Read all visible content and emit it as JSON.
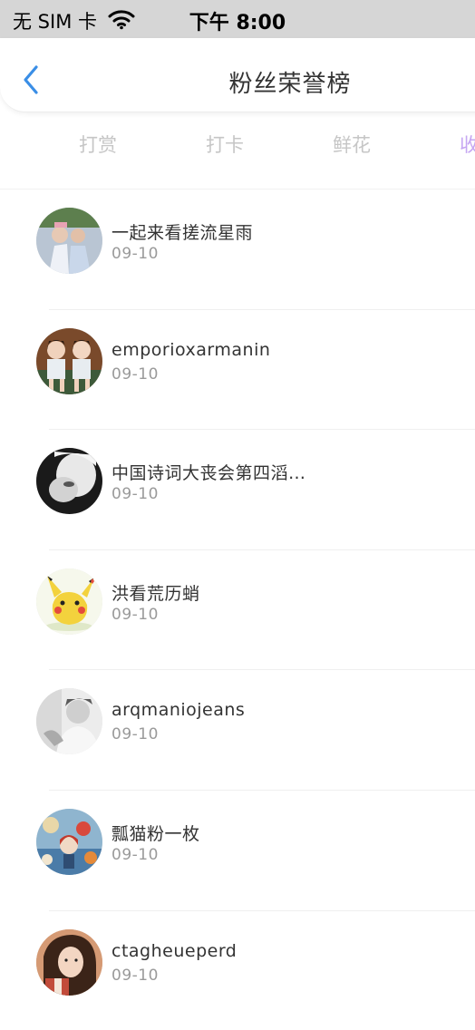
{
  "status_bar": {
    "carrier": "无 SIM 卡",
    "time": "下午 8:00"
  },
  "nav": {
    "title": "粉丝荣誉榜"
  },
  "tabs": [
    {
      "label": "打赏",
      "active": false
    },
    {
      "label": "打卡",
      "active": false
    },
    {
      "label": "鲜花",
      "active": false
    },
    {
      "label": "收",
      "active": true
    }
  ],
  "fans": [
    {
      "name": "一起来看搓流星雨",
      "date": "09-10"
    },
    {
      "name": "emporioxarmanin",
      "date": "09-10"
    },
    {
      "name": "中国诗词大丧会第四滔…",
      "date": "09-10"
    },
    {
      "name": "洪看荒历蛸",
      "date": "09-10"
    },
    {
      "name": "arqmaniojeans",
      "date": "09-10"
    },
    {
      "name": "瓢猫粉一枚",
      "date": "09-10"
    },
    {
      "name": "ctagheueperd",
      "date": "09-10"
    }
  ],
  "colors": {
    "accent_tab": "#c5a6f2",
    "back_icon": "#3a8ee6",
    "status_bar_bg": "#d6d6d6"
  },
  "icons": [
    "wifi-icon",
    "back-chevron-icon"
  ]
}
